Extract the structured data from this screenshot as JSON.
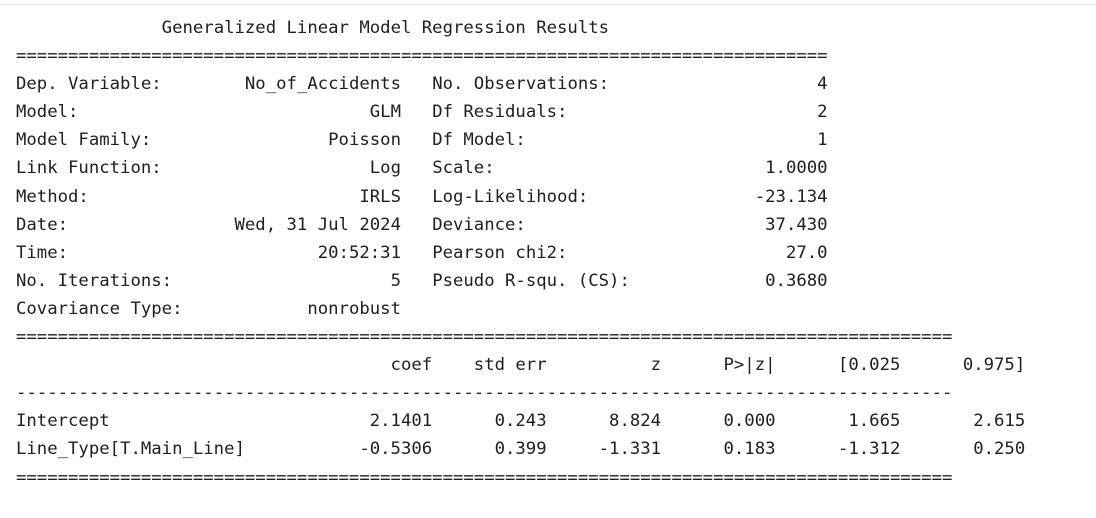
{
  "title": "Generalized Linear Model Regression Results",
  "rule_double": "=",
  "rule_single": "-",
  "info_rows": [
    {
      "left_label": "Dep. Variable:",
      "left_value": "No_of_Accidents",
      "right_label": "No. Observations:",
      "right_value": "4"
    },
    {
      "left_label": "Model:",
      "left_value": "GLM",
      "right_label": "Df Residuals:",
      "right_value": "2"
    },
    {
      "left_label": "Model Family:",
      "left_value": "Poisson",
      "right_label": "Df Model:",
      "right_value": "1"
    },
    {
      "left_label": "Link Function:",
      "left_value": "Log",
      "right_label": "Scale:",
      "right_value": "1.0000"
    },
    {
      "left_label": "Method:",
      "left_value": "IRLS",
      "right_label": "Log-Likelihood:",
      "right_value": "-23.134"
    },
    {
      "left_label": "Date:",
      "left_value": "Wed, 31 Jul 2024",
      "right_label": "Deviance:",
      "right_value": "37.430"
    },
    {
      "left_label": "Time:",
      "left_value": "20:52:31",
      "right_label": "Pearson chi2:",
      "right_value": "27.0"
    },
    {
      "left_label": "No. Iterations:",
      "left_value": "5",
      "right_label": "Pseudo R-squ. (CS):",
      "right_value": "0.3680"
    },
    {
      "left_label": "Covariance Type:",
      "left_value": "nonrobust",
      "right_label": "",
      "right_value": ""
    }
  ],
  "coef_headers": [
    "coef",
    "std err",
    "z",
    "P>|z|",
    "[0.025",
    "0.975]"
  ],
  "coef_rows": [
    {
      "name": "Intercept",
      "values": [
        "2.1401",
        "0.243",
        "8.824",
        "0.000",
        "1.665",
        "2.615"
      ]
    },
    {
      "name": "Line_Type[T.Main_Line]",
      "values": [
        "-0.5306",
        "0.399",
        "-1.331",
        "0.183",
        "-1.312",
        "0.250"
      ]
    }
  ]
}
